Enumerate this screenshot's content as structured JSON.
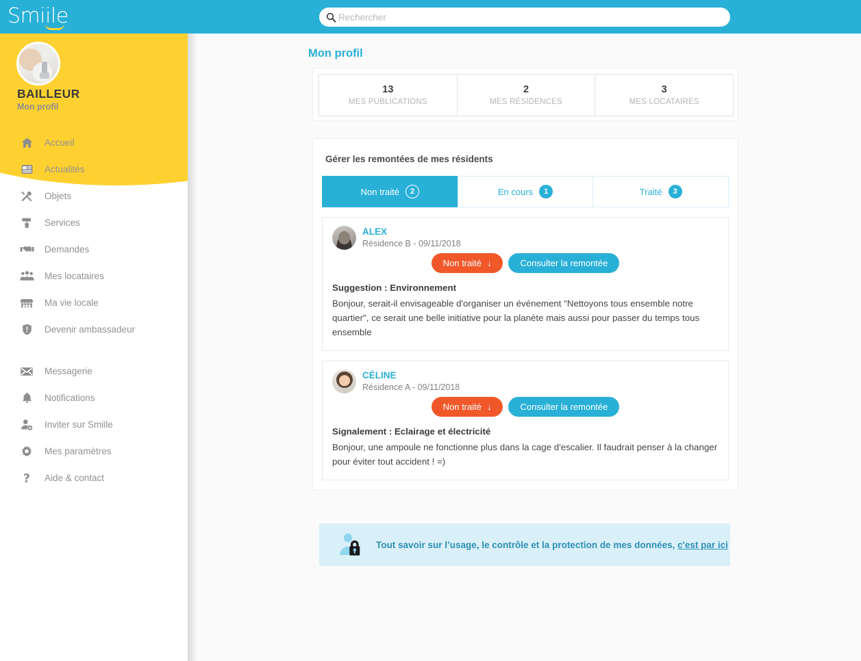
{
  "app": {
    "brand": "Smiile",
    "accent_blue": "#29b0d7",
    "accent_yellow": "#fed130",
    "accent_orange": "#f0582a"
  },
  "search": {
    "placeholder": "Rechercher",
    "value": "",
    "icon": "search-icon"
  },
  "profile": {
    "name": "BAILLEUR",
    "subtitle": "Mon profil",
    "avatar": "landlord-keys-photo"
  },
  "sidebar": {
    "items": [
      {
        "label": "Accueil",
        "icon": "home-icon"
      },
      {
        "label": "Actualités",
        "icon": "newspaper-icon"
      },
      {
        "label": "Objets",
        "icon": "tools-icon"
      },
      {
        "label": "Services",
        "icon": "paint-roller-icon"
      },
      {
        "label": "Demandes",
        "icon": "handshake-icon"
      },
      {
        "label": "Mes locataires",
        "icon": "people-group-icon"
      },
      {
        "label": "Ma vie locale",
        "icon": "storefront-icon"
      },
      {
        "label": "Devenir ambassadeur",
        "icon": "shield-icon"
      }
    ],
    "items2": [
      {
        "label": "Messagerie",
        "icon": "envelope-icon"
      },
      {
        "label": "Notifications",
        "icon": "bell-icon"
      },
      {
        "label": "Inviter sur Smiile",
        "icon": "user-plus-icon"
      },
      {
        "label": "Mes paramètres",
        "icon": "gear-icon"
      },
      {
        "label": "Aide & contact",
        "icon": "question-mark-icon"
      }
    ]
  },
  "main": {
    "page_title": "Mon profil",
    "stats": [
      {
        "value": "13",
        "label": "MES PUBLICATIONS"
      },
      {
        "value": "2",
        "label": "MES RÉSIDENCES"
      },
      {
        "value": "3",
        "label": "MES LOCATAIRES"
      }
    ],
    "panel_title": "Gérer les remontées de mes résidents",
    "tabs": [
      {
        "label": "Non traité",
        "count": "2",
        "active": true
      },
      {
        "label": "En cours",
        "count": "1",
        "active": false
      },
      {
        "label": "Traité",
        "count": "3",
        "active": false
      }
    ],
    "posts": [
      {
        "author": "ALEX",
        "meta": "Résidence B - 09/11/2018",
        "status_label": "Non traité",
        "consult_label": "Consulter la remontée",
        "subject": "Suggestion : Environnement",
        "body": "Bonjour, serait-il envisageable d'organiser un événement \"Nettoyons tous ensemble notre quartier\", ce serait une belle initiative pour la planète mais aussi pour passer du temps tous ensemble",
        "avatar": "alex-portrait"
      },
      {
        "author": "CÉLINE",
        "meta": "Résidence A - 09/11/2018",
        "status_label": "Non traité",
        "consult_label": "Consulter la remontée",
        "subject": "Signalement : Eclairage et électricité",
        "body": "Bonjour, une ampoule ne fonctionne plus dans la cage d'escalier. Il faudrait penser à la changer pour éviter tout accident ! =)",
        "avatar": "celine-portrait"
      }
    ],
    "privacy": {
      "text": "Tout savoir sur l’usage, le contrôle et la protection de mes données,",
      "link": "c'est par ici",
      "icon": "user-lock-icon"
    }
  }
}
